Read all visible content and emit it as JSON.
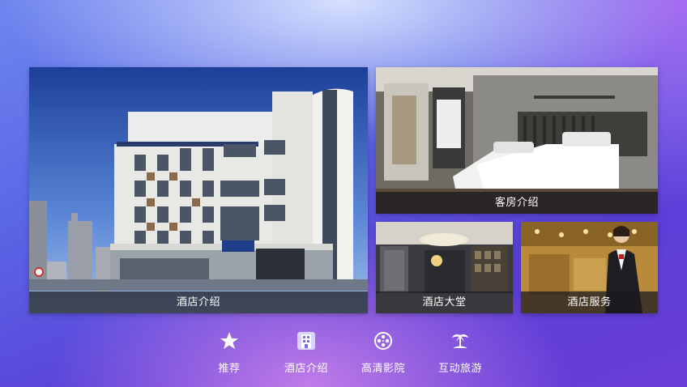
{
  "tiles": {
    "hotel_intro": {
      "label": "酒店介绍"
    },
    "room_intro": {
      "label": "客房介绍"
    },
    "lobby": {
      "label": "酒店大堂"
    },
    "service": {
      "label": "酒店服务"
    }
  },
  "nav": {
    "items": [
      {
        "label": "推荐",
        "icon": "star-icon",
        "active": false
      },
      {
        "label": "酒店介绍",
        "icon": "building-icon",
        "active": true
      },
      {
        "label": "高清影院",
        "icon": "film-reel-icon",
        "active": false
      },
      {
        "label": "互动旅游",
        "icon": "palm-tree-icon",
        "active": false
      }
    ]
  },
  "colors": {
    "caption_bg": "#19191e",
    "active_icon": "#e9e6ff",
    "inactive_icon": "#ffffff"
  }
}
